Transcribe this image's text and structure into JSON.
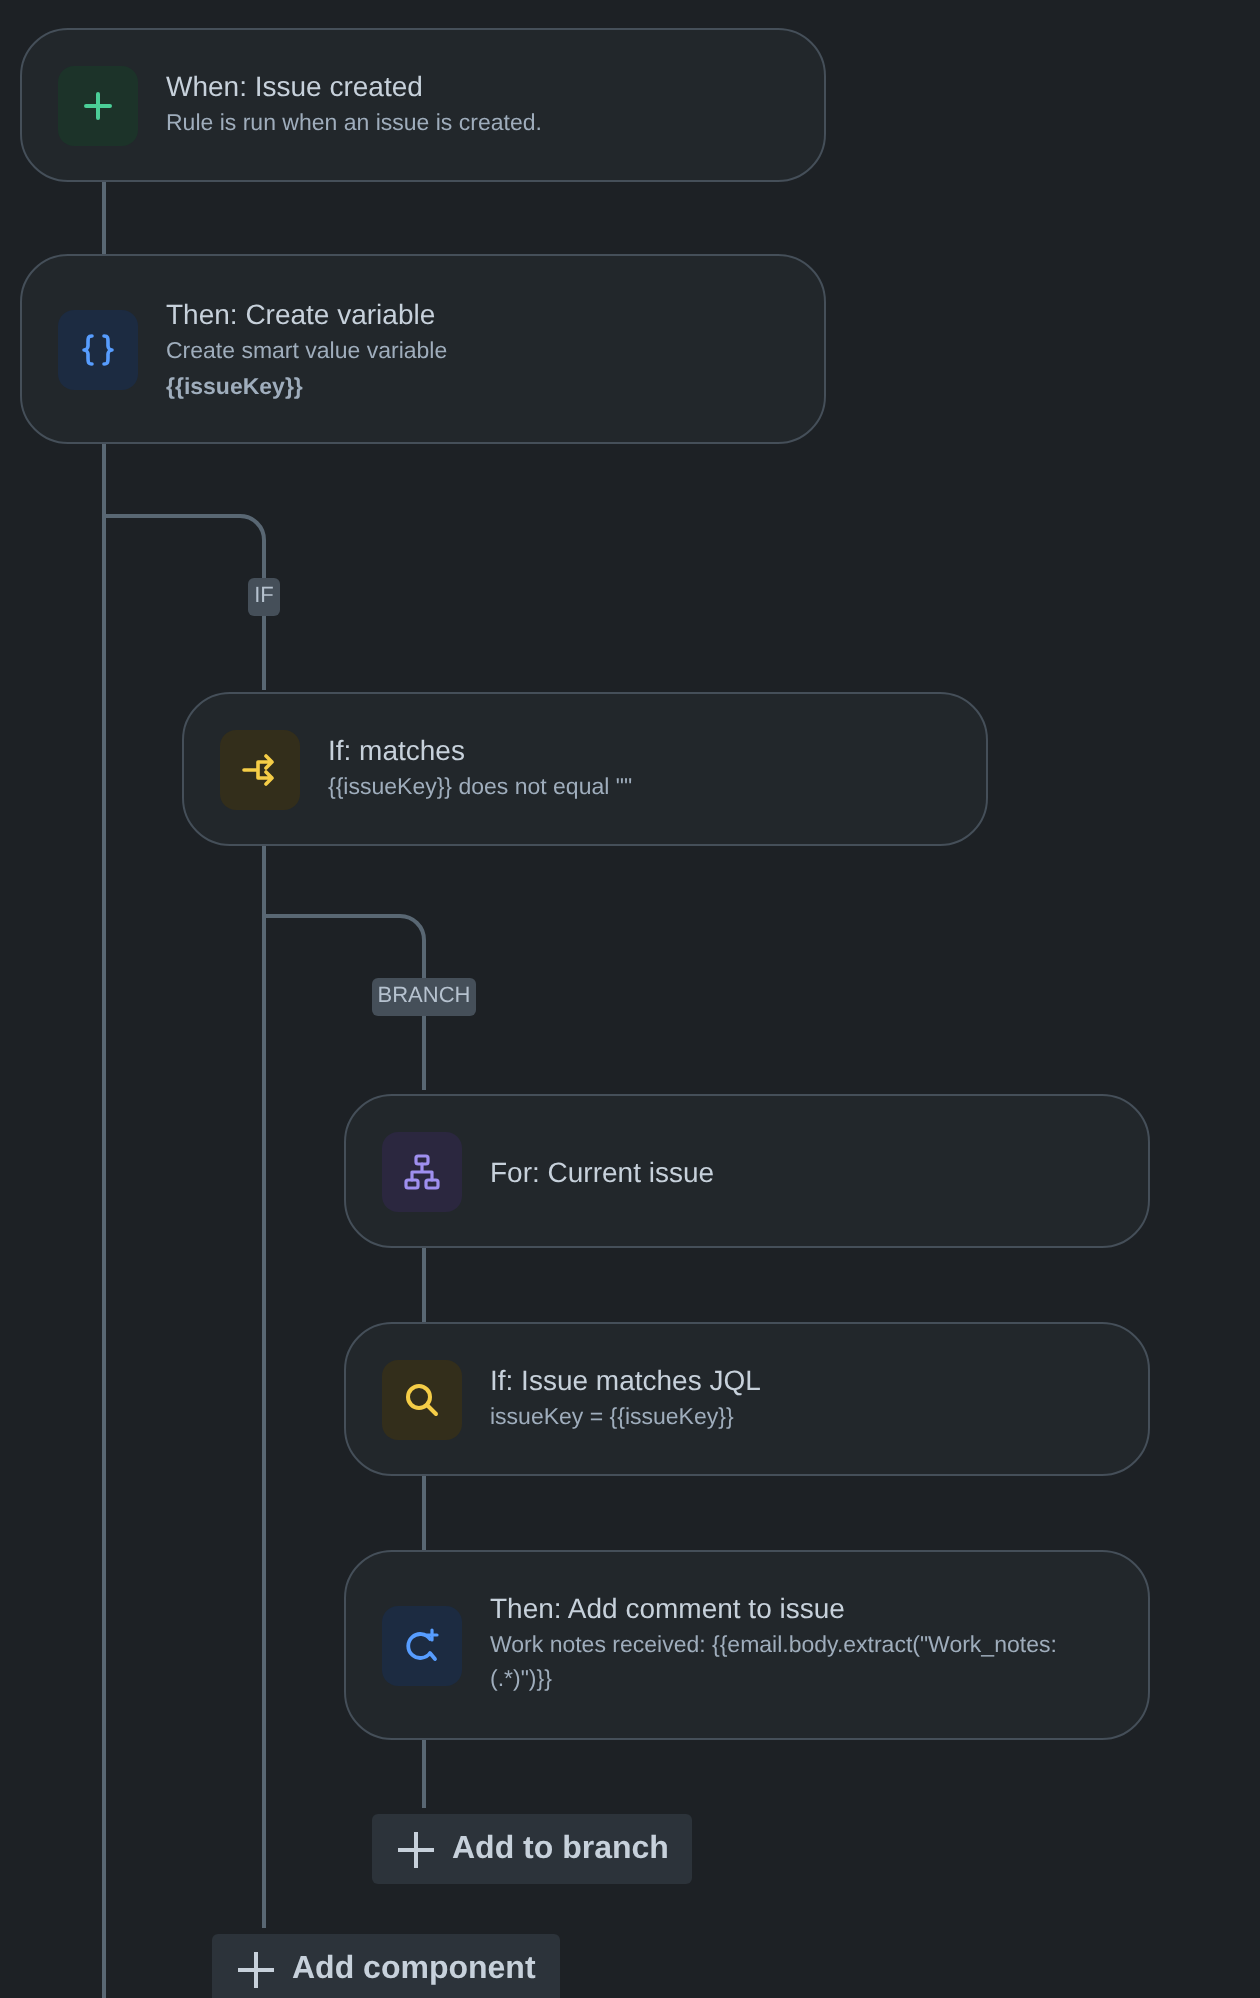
{
  "rule": {
    "steps": [
      {
        "kind": "trigger",
        "title": "When: Issue created",
        "description": "Rule is run when an issue is created."
      },
      {
        "kind": "variable",
        "title": "Then: Create variable",
        "description": "Create smart value variable",
        "detail": "{{issueKey}}"
      },
      {
        "kind": "condition",
        "connector_label": "IF",
        "title": "If: matches",
        "description": "{{issueKey}} does not equal \"\"",
        "add_button": "Add component",
        "branches": [
          {
            "connector_label": "BRANCH",
            "add_button": "Add to branch",
            "steps": [
              {
                "kind": "branch",
                "title": "For: Current issue"
              },
              {
                "kind": "jql",
                "title": "If: Issue matches JQL",
                "description": "issueKey = {{issueKey}}"
              },
              {
                "kind": "comment",
                "title": "Then: Add comment to issue",
                "description": "Work notes received: {{email.body.extract(\"Work_notes: (.*)\")}}"
              }
            ]
          }
        ]
      }
    ]
  }
}
